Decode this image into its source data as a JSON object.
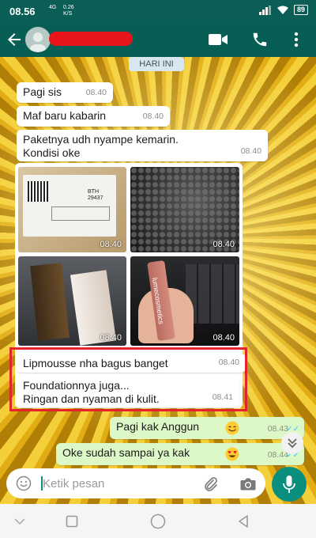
{
  "status_bar": {
    "time": "08.56",
    "network_type": "4G",
    "speed_value": "0.26",
    "speed_unit": "K/S",
    "battery": "89"
  },
  "header": {
    "back_icon": "arrow-left-icon",
    "video_icon": "video-call-icon",
    "call_icon": "phone-icon",
    "menu_icon": "more-vertical-icon"
  },
  "chat": {
    "date_label": "HARI INI",
    "messages": [
      {
        "text": "Pagi sis",
        "time": "08.40"
      },
      {
        "text": "Maf baru kabarin",
        "time": "08.40"
      },
      {
        "text": "Paketnya udh nyampe kemarin.",
        "text2": "Kondisi oke",
        "time": "08.40"
      },
      {
        "text": "Lipmousse nha bagus banget",
        "time": "08.40"
      },
      {
        "text": "Foundationnya juga...",
        "text2": "Ringan dan nyaman di kulit.",
        "time": "08.41"
      }
    ],
    "media": [
      {
        "time": "08.40",
        "label": "BTH",
        "code": "29437"
      },
      {
        "time": "08.40"
      },
      {
        "time": "08.40"
      },
      {
        "time": "08.40",
        "brand": "lumecosmetics"
      }
    ],
    "outgoing": [
      {
        "text": "Pagi kak Anggun",
        "time": "08.43",
        "emoji": "smile-emoji"
      },
      {
        "text": "Oke sudah sampai ya kak",
        "time": "08.44",
        "emoji": "heart-eyes-emoji"
      }
    ]
  },
  "composer": {
    "placeholder": "Ketik pesan"
  },
  "nav": {
    "back": "triangle-back-icon",
    "home": "circle-home-icon",
    "recents": "square-recents-icon"
  }
}
